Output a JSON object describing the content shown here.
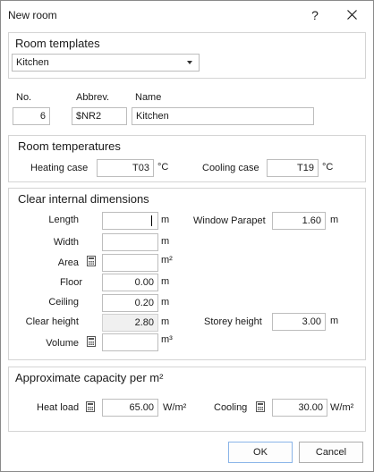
{
  "window": {
    "title": "New room",
    "help": "?"
  },
  "templates": {
    "title": "Room templates",
    "selected": "Kitchen"
  },
  "ident": {
    "no_label": "No.",
    "no_value": "6",
    "abbrev_label": "Abbrev.",
    "abbrev_value": "$NR2",
    "name_label": "Name",
    "name_value": "Kitchen"
  },
  "temps": {
    "title": "Room temperatures",
    "heating_label": "Heating case",
    "heating_value": "T03",
    "heating_unit": "°C",
    "cooling_label": "Cooling case",
    "cooling_value": "T19",
    "cooling_unit": "°C"
  },
  "dims": {
    "title": "Clear internal dimensions",
    "length_label": "Length",
    "length_value": "",
    "length_unit": "m",
    "width_label": "Width",
    "width_value": "",
    "width_unit": "m",
    "area_label": "Area",
    "area_value": "",
    "area_unit": "m²",
    "floor_label": "Floor",
    "floor_value": "0.00",
    "floor_unit": "m",
    "ceiling_label": "Ceiling",
    "ceiling_value": "0.20",
    "ceiling_unit": "m",
    "clear_height_label": "Clear height",
    "clear_height_value": "2.80",
    "clear_height_unit": "m",
    "volume_label": "Volume",
    "volume_value": "",
    "volume_unit": "m³",
    "parapet_label": "Window Parapet",
    "parapet_value": "1.60",
    "parapet_unit": "m",
    "storey_label": "Storey height",
    "storey_value": "3.00",
    "storey_unit": "m"
  },
  "capacity": {
    "title": "Approximate capacity per m²",
    "heat_label": "Heat load",
    "heat_value": "65.00",
    "heat_unit": "W/m²",
    "cool_label": "Cooling",
    "cool_value": "30.00",
    "cool_unit": "W/m²"
  },
  "buttons": {
    "ok": "OK",
    "cancel": "Cancel"
  },
  "icons": {
    "close": "close-icon",
    "calculator": "calculator-icon",
    "dropdown": "chevron-down-icon"
  }
}
